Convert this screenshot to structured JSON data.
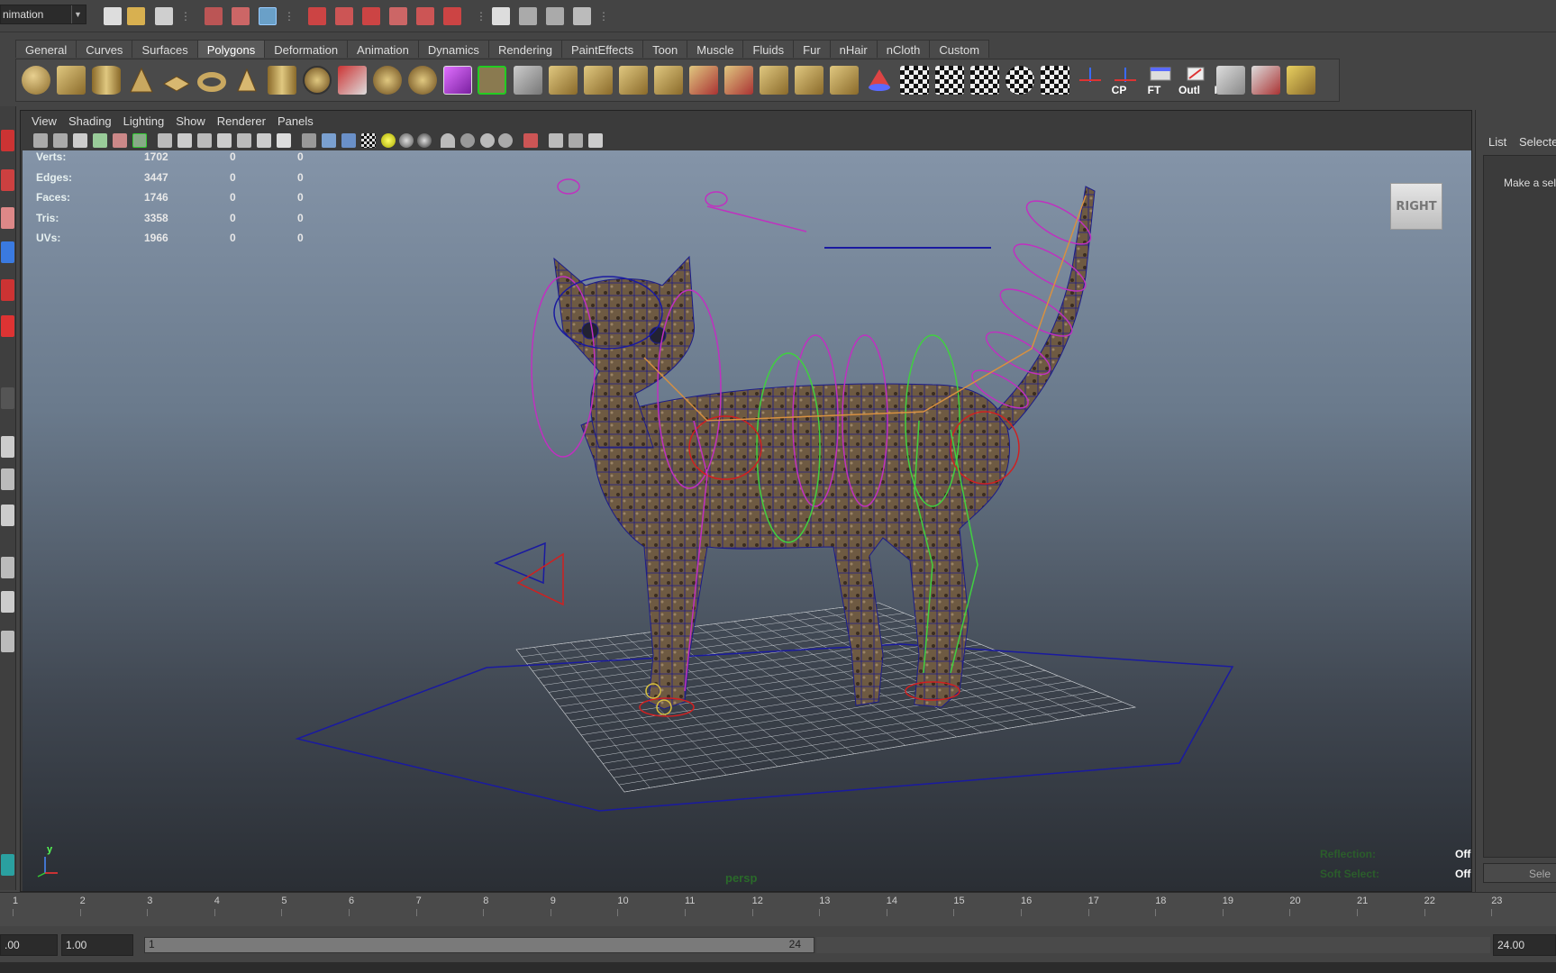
{
  "status_line": {
    "menu_set": "nimation"
  },
  "shelf": {
    "tabs": [
      "General",
      "Curves",
      "Surfaces",
      "Polygons",
      "Deformation",
      "Animation",
      "Dynamics",
      "Rendering",
      "PaintEffects",
      "Toon",
      "Muscle",
      "Fluids",
      "Fur",
      "nHair",
      "nCloth",
      "Custom"
    ],
    "active_tab": "Polygons",
    "labeled_buttons": {
      "cp": "CP",
      "ft": "FT",
      "outl": "Outl",
      "hist": "Hist"
    }
  },
  "panel": {
    "menus": [
      "View",
      "Shading",
      "Lighting",
      "Show",
      "Renderer",
      "Panels"
    ]
  },
  "hud": {
    "rows": [
      {
        "label": "Verts:",
        "v1": "1702",
        "v2": "0",
        "v3": "0"
      },
      {
        "label": "Edges:",
        "v1": "3447",
        "v2": "0",
        "v3": "0"
      },
      {
        "label": "Faces:",
        "v1": "1746",
        "v2": "0",
        "v3": "0"
      },
      {
        "label": "Tris:",
        "v1": "3358",
        "v2": "0",
        "v3": "0"
      },
      {
        "label": "UVs:",
        "v1": "1966",
        "v2": "0",
        "v3": "0"
      }
    ],
    "camera_name": "persp",
    "reflection_label": "Reflection:",
    "reflection_value": "Off",
    "soft_select_label": "Soft Select:",
    "soft_select_value": "Off",
    "axis_y": "y",
    "view_cube_face": "RIGHT"
  },
  "side_panel": {
    "tab_list": "List",
    "tab_selected": "Selecte",
    "hint": "Make a sel",
    "button": "Sele"
  },
  "time_slider": {
    "ticks": [
      "1",
      "2",
      "3",
      "4",
      "5",
      "6",
      "7",
      "8",
      "9",
      "10",
      "11",
      "12",
      "13",
      "14",
      "15",
      "16",
      "17",
      "18",
      "19",
      "20",
      "21",
      "22",
      "23"
    ]
  },
  "range_slider": {
    "start_time": ".00",
    "playback_start": "1.00",
    "range_start": "1",
    "range_end": "24",
    "end_time": "24.00"
  },
  "colors": {
    "viewport_top": "#8494a8",
    "viewport_bottom": "#2a2e34",
    "hud_green": "#2b5d2b",
    "wire_blue": "#1a1aa0",
    "control_magenta": "#c030c0",
    "control_green": "#40d040",
    "control_red": "#d02020"
  }
}
